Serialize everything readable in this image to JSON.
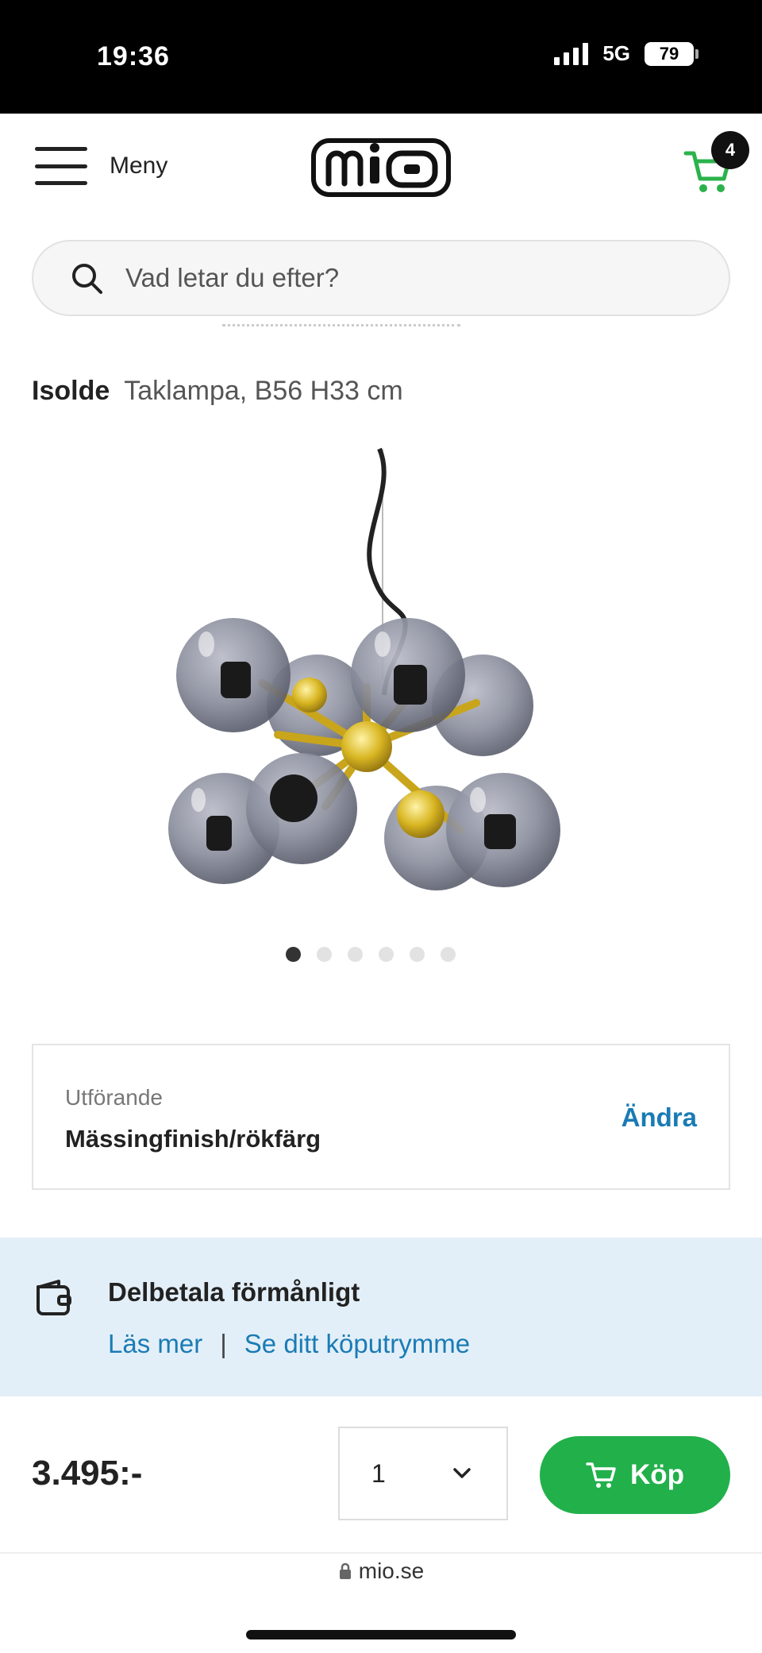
{
  "status_bar": {
    "time": "19:36",
    "network": "5G",
    "battery": "79"
  },
  "header": {
    "menu_label": "Meny",
    "logo_text": "mio",
    "cart_count": "4"
  },
  "search": {
    "placeholder": "Vad letar du efter?"
  },
  "product": {
    "name": "Isolde",
    "description": "Taklampa, B56 H33 cm",
    "image_icon": "ceiling-lamp-image",
    "carousel": {
      "total": 6,
      "active_index": 0
    }
  },
  "variant": {
    "label": "Utförande",
    "value": "Mässingfinish/rökfärg",
    "change_label": "Ändra"
  },
  "finance": {
    "title": "Delbetala förmånligt",
    "link_read_more": "Läs mer",
    "separator": "|",
    "link_purchase_room": "Se ditt köputrymme"
  },
  "buy_bar": {
    "price": "3.495:-",
    "quantity": "1",
    "buy_label": "Köp"
  },
  "url": {
    "domain": "mio.se"
  },
  "colors": {
    "accent_green": "#22b04b",
    "link_blue": "#1a7bb5",
    "finance_bg": "#e3eff8"
  }
}
